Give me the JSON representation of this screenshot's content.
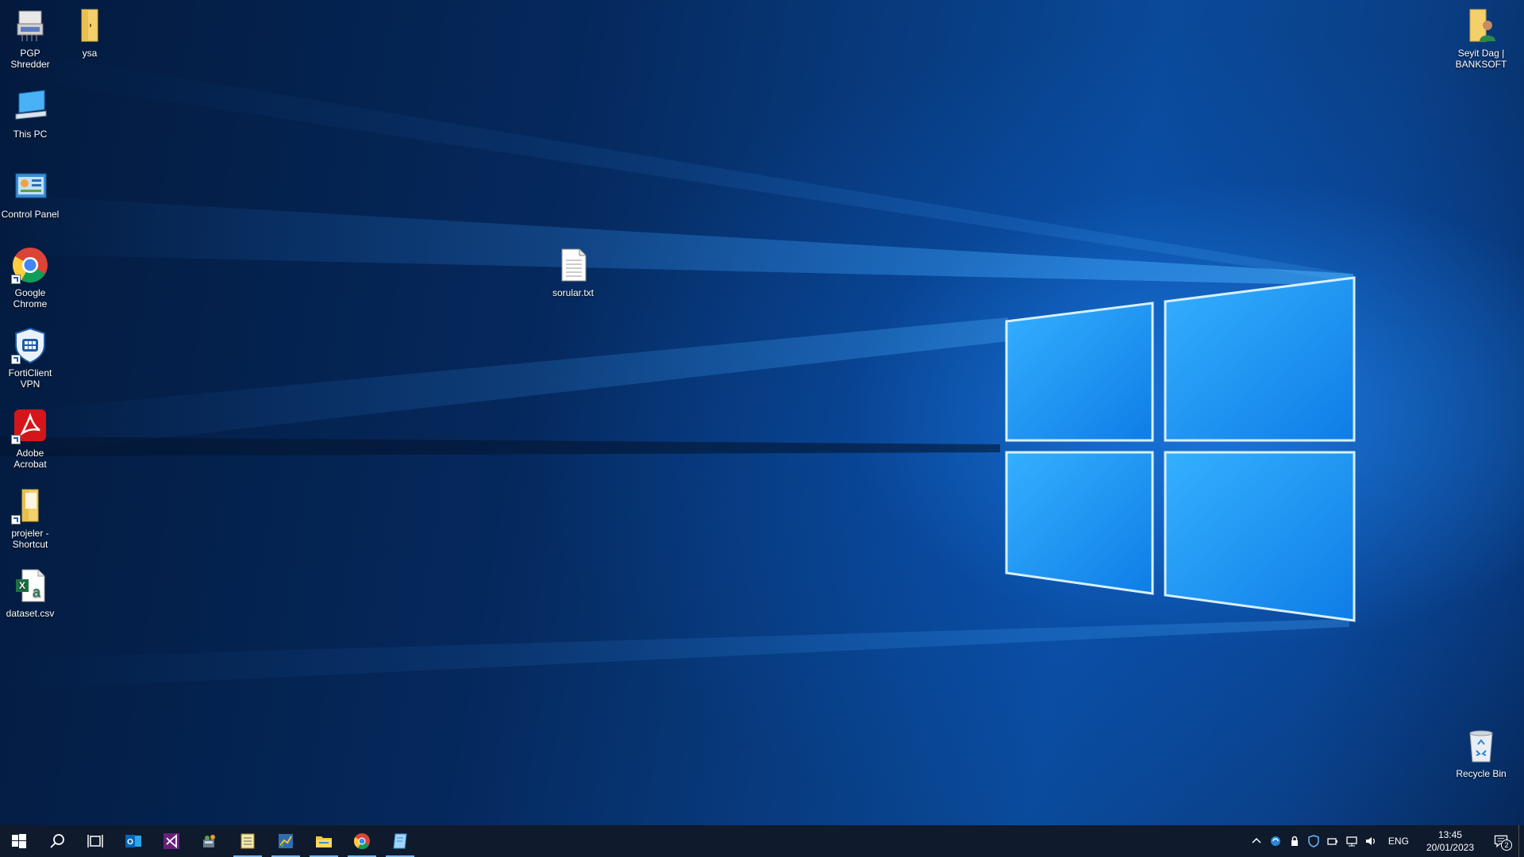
{
  "desktop": {
    "icons_left": [
      {
        "label": "PGP Shredder",
        "icon": "shredder-icon"
      },
      {
        "label": "ysa",
        "icon": "folder-icon"
      },
      {
        "label": "This PC",
        "icon": "computer-icon"
      },
      {
        "label": "Control Panel",
        "icon": "control-panel-icon"
      },
      {
        "label": "Google Chrome",
        "icon": "chrome-icon"
      },
      {
        "label": "FortiClient VPN",
        "icon": "forticlient-icon"
      },
      {
        "label": "Adobe Acrobat",
        "icon": "acrobat-icon"
      },
      {
        "label": "projeler - Shortcut",
        "icon": "folder-shortcut-icon"
      },
      {
        "label": "dataset.csv",
        "icon": "excel-csv-icon"
      }
    ],
    "file_icon": {
      "label": "sorular.txt",
      "icon": "text-file-icon"
    },
    "user_folder": {
      "label": "Seyit Dag | BANKSOFT",
      "icon": "user-folder-icon"
    },
    "recycle_bin": {
      "label": "Recycle Bin",
      "icon": "recycle-bin-icon"
    }
  },
  "taskbar": {
    "apps": [
      {
        "icon": "windows-start-icon",
        "running": false
      },
      {
        "icon": "search-icon",
        "running": false
      },
      {
        "icon": "task-view-icon",
        "running": false
      },
      {
        "icon": "outlook-icon",
        "running": false
      },
      {
        "icon": "visual-studio-icon",
        "running": false
      },
      {
        "icon": "network-tool-icon",
        "running": false
      },
      {
        "icon": "notepad-app-icon",
        "running": true
      },
      {
        "icon": "chart-tool-icon",
        "running": true
      },
      {
        "icon": "file-explorer-icon",
        "running": true
      },
      {
        "icon": "chrome-icon",
        "running": true
      },
      {
        "icon": "notes-app-icon",
        "running": true
      }
    ],
    "tray": {
      "language": "ENG",
      "time": "13:45",
      "date": "20/01/2023",
      "notification_count": "2"
    }
  },
  "colors": {
    "taskbar_bg": "#0f1a2c",
    "running_indicator": "#76b9ed",
    "logo_light": "#2fa8ff"
  }
}
